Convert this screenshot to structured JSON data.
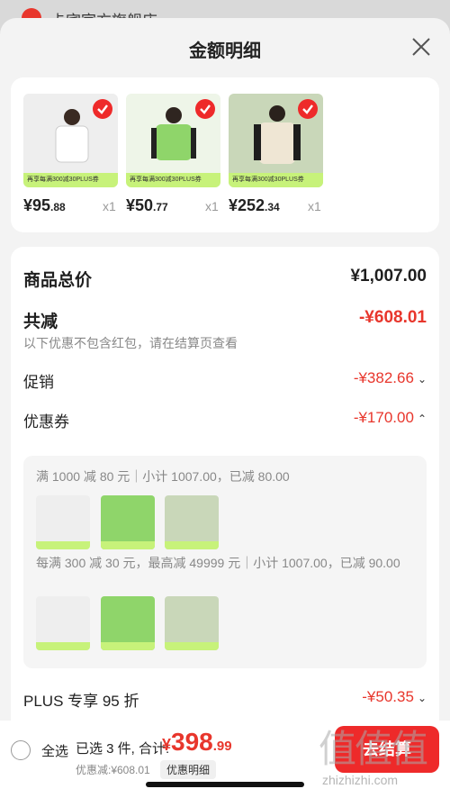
{
  "background_page": {
    "store_name": "卡宾官方旗舰店 ›"
  },
  "sheet": {
    "title": "金额明细"
  },
  "products": [
    {
      "price_int": "¥95",
      "price_dec": ".88",
      "qty": "x1",
      "img_color": "#eeeeee",
      "promo": "再享每满300减30PLUS券"
    },
    {
      "price_int": "¥50",
      "price_dec": ".77",
      "qty": "x1",
      "img_color": "#8fd56a",
      "promo": "再享每满300减30PLUS券"
    },
    {
      "price_int": "¥252",
      "price_dec": ".34",
      "qty": "x1",
      "img_color": "#c9d7b9",
      "promo": "再享每满300减30PLUS券"
    }
  ],
  "summary": {
    "total_label": "商品总价",
    "total_value": "¥1,007.00",
    "reduce_label": "共减",
    "reduce_value": "-¥608.01",
    "reduce_note": "以下优惠不包含红包，请在结算页查看",
    "promo_label": "促销",
    "promo_value": "-¥382.66",
    "coupon_label": "优惠券",
    "coupon_value": "-¥170.00",
    "plus_label": "PLUS 专享 95 折",
    "plus_value": "-¥50.35"
  },
  "coupons": [
    {
      "text": "满 1000 减 80 元｜小计 1007.00，已减 80.00"
    },
    {
      "text": "每满 300 减 30 元，最高减 49999 元｜小计 1007.00，已减 90.00"
    }
  ],
  "bottom_bar": {
    "select_all": "全选",
    "selected_text": "已选 3 件, 合计:",
    "total_currency": "¥",
    "total_int": "398",
    "total_dec": ".99",
    "discount_text": "优惠减:¥608.01",
    "detail_link": "优惠明细",
    "checkout": "去结算"
  },
  "watermark": {
    "big": "值值值",
    "small": "zhizhizhi.com"
  },
  "colors": {
    "accent": "#e8362c",
    "checkout": "#ee2a2a",
    "promo_band": "#c7f27a"
  }
}
